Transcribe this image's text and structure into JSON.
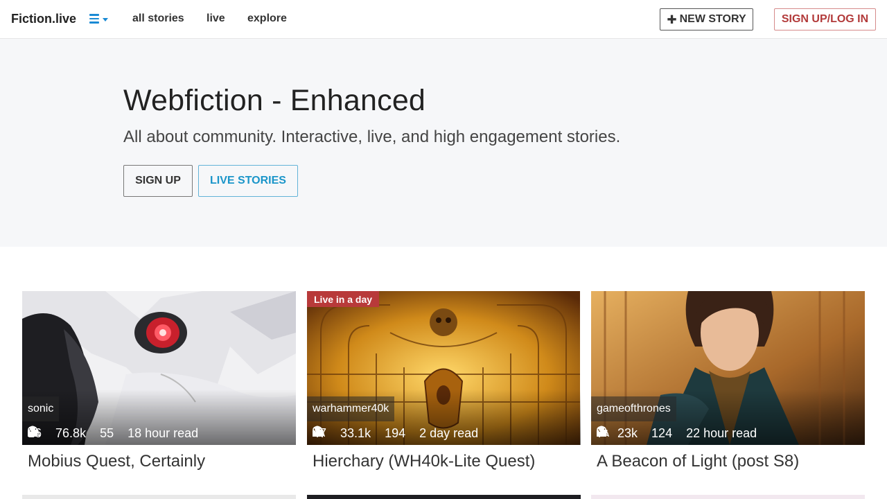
{
  "nav": {
    "brand": "Fiction.live",
    "links": [
      "all stories",
      "live",
      "explore"
    ],
    "new_story": "NEW STORY",
    "login": "SIGN UP/LOG IN"
  },
  "hero": {
    "title": "Webfiction - Enhanced",
    "subtitle": "All about community. Interactive, live, and high engagement stories.",
    "signup": "SIGN UP",
    "live": "LIVE STORIES"
  },
  "stories": [
    {
      "tag": "sonic",
      "readers": "16",
      "comments": "76.8k",
      "likes": "55",
      "read_time": "18 hour read",
      "title": "Mobius Quest, Certainly",
      "badge": ""
    },
    {
      "tag": "warhammer40k",
      "readers": "47",
      "comments": "33.1k",
      "likes": "194",
      "read_time": "2 day read",
      "title": "Hierchary (WH40k-Lite Quest)",
      "badge": "Live in a day"
    },
    {
      "tag": "gameofthrones",
      "readers": "7",
      "comments": "23k",
      "likes": "124",
      "read_time": "22 hour read",
      "title": "A Beacon of Light (post S8)",
      "badge": ""
    }
  ],
  "icons": {
    "readers": "user-icon",
    "comments": "comments-icon",
    "likes": "thumbs-up-icon",
    "menu": "bars-icon"
  },
  "colors": {
    "accent": "#1a8ad4",
    "login": "#b23a3a",
    "live_badge": "#b83a3a",
    "hero_bg": "#f6f7f9"
  }
}
